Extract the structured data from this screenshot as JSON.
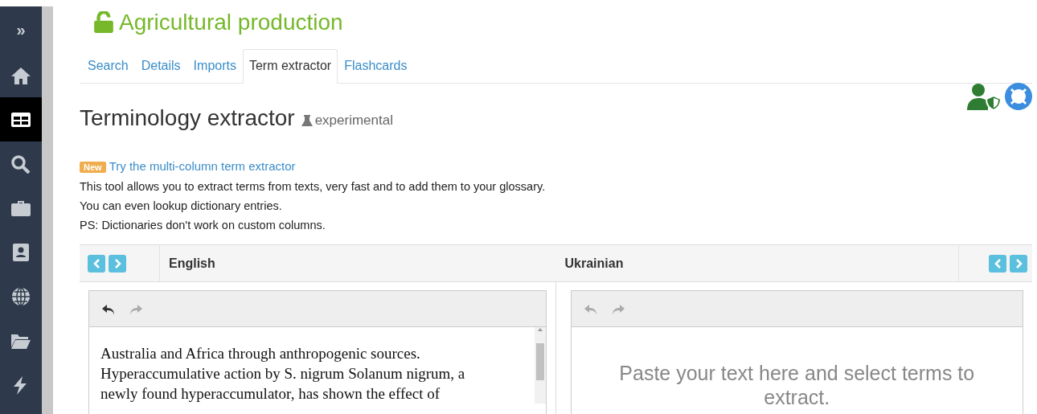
{
  "sidebar": {
    "toggle": "»",
    "items": [
      {
        "selected": false
      },
      {
        "selected": true
      },
      {
        "selected": false
      },
      {
        "selected": false
      },
      {
        "selected": false
      },
      {
        "selected": false
      },
      {
        "selected": false
      },
      {
        "selected": false
      }
    ]
  },
  "project": {
    "title": "Agricultural production",
    "locked": false
  },
  "tabs": [
    {
      "label": "Search",
      "selected": false
    },
    {
      "label": "Details",
      "selected": false
    },
    {
      "label": "Imports",
      "selected": false
    },
    {
      "label": "Term extractor",
      "selected": true
    },
    {
      "label": "Flashcards",
      "selected": false
    }
  ],
  "heading": {
    "title": "Terminology extractor",
    "tag": "experimental"
  },
  "notice": {
    "badge": "New",
    "link": "Try the multi-column term extractor",
    "lines": [
      "This tool allows you to extract terms from texts, very fast and to add them to your glossary.",
      "You can even lookup dictionary entries.",
      "PS: Dictionaries don't work on custom columns."
    ]
  },
  "columns": [
    {
      "language": "English",
      "kind": "source",
      "undo_enabled": true,
      "redo_enabled": false,
      "lines": [
        "Australia and Africa through anthropogenic sources.",
        "Hyperaccumulative action by S. nigrum Solanum nigrum, a",
        "newly found hyperaccumulator, has shown the effect of"
      ]
    },
    {
      "language": "Ukrainian",
      "kind": "target",
      "undo_enabled": false,
      "redo_enabled": false,
      "placeholder": "Paste your text here and select terms to extract."
    }
  ]
}
